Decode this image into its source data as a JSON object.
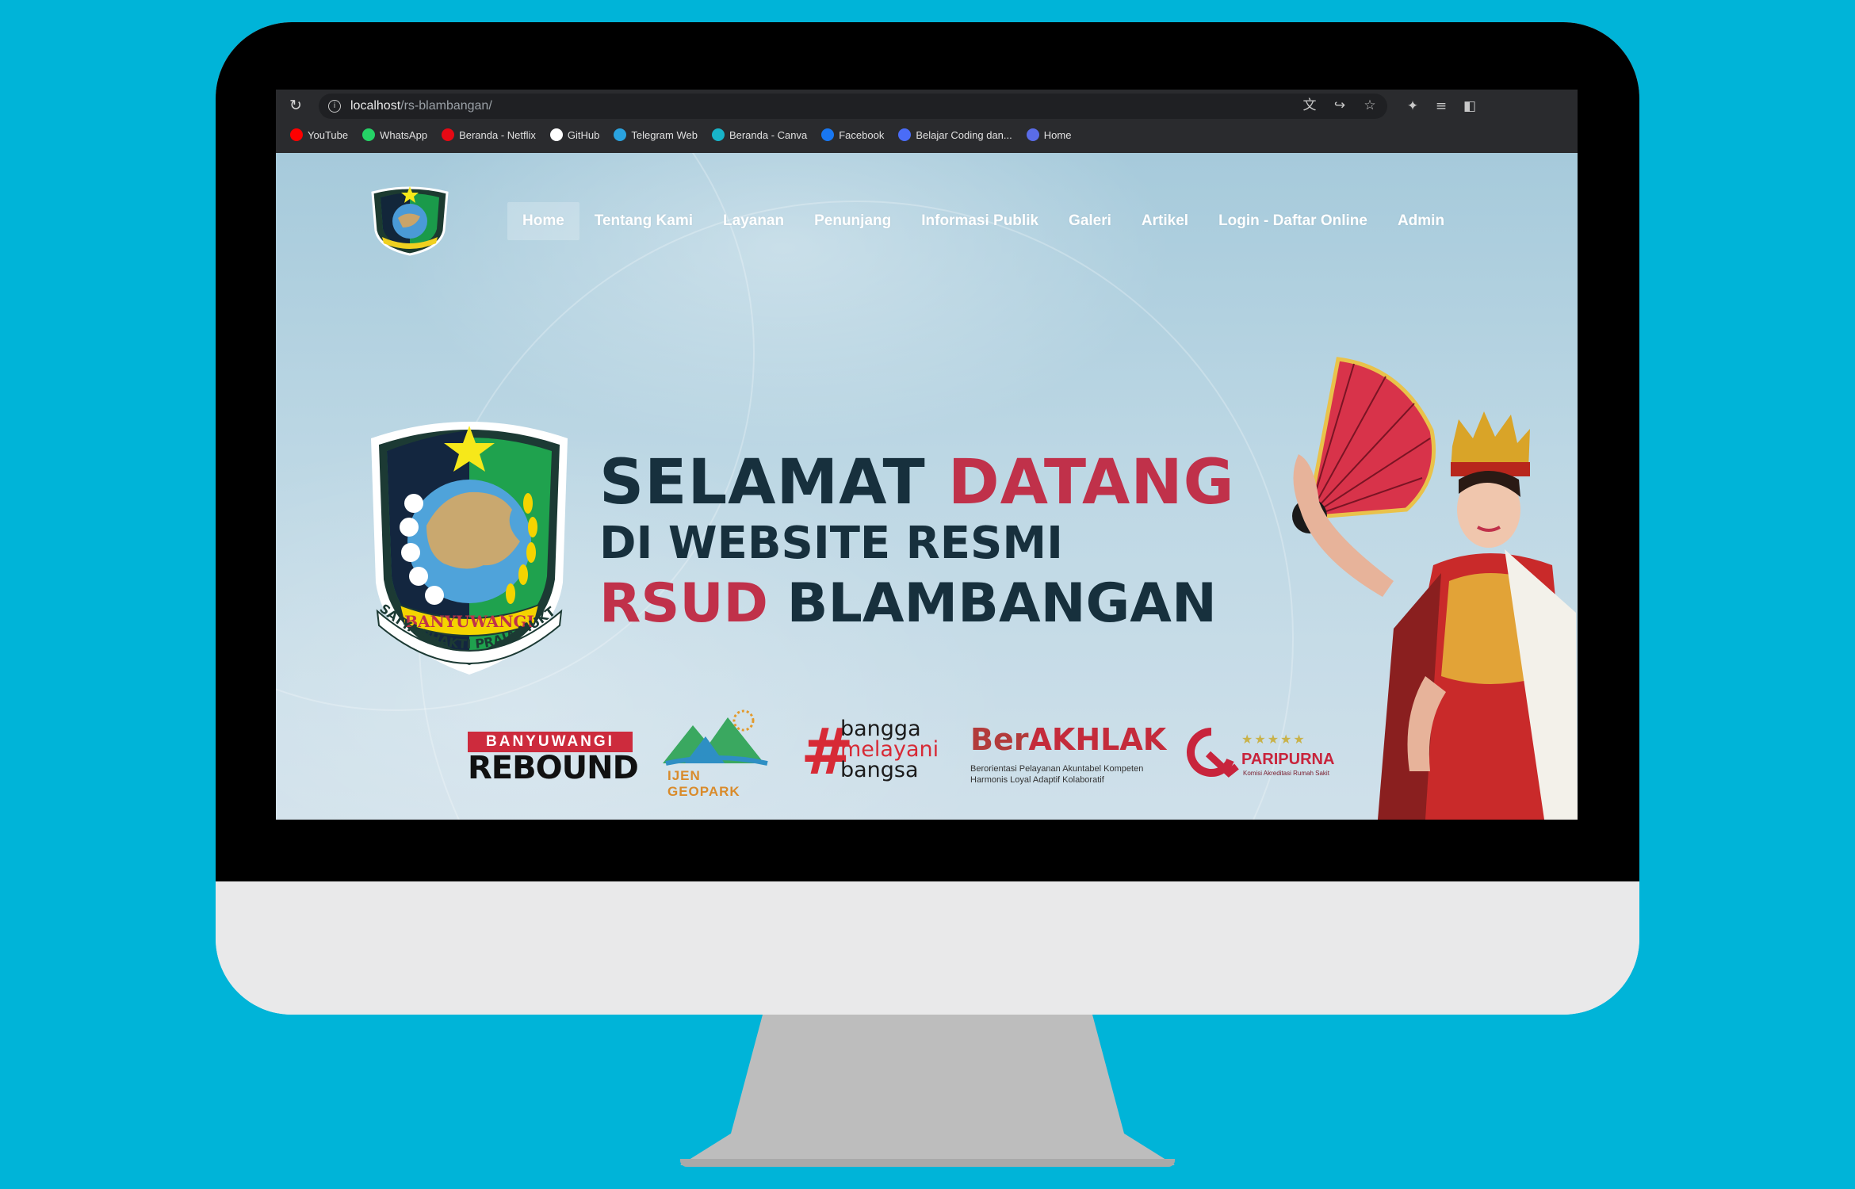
{
  "browser": {
    "url_host": "localhost",
    "url_path": "/rs-blambangan/",
    "bookmarks": [
      {
        "label": "YouTube",
        "icon": "youtube-icon",
        "color": "#ff0000"
      },
      {
        "label": "WhatsApp",
        "icon": "whatsapp-icon",
        "color": "#25d366"
      },
      {
        "label": "Beranda - Netflix",
        "icon": "netflix-icon",
        "color": "#e50914"
      },
      {
        "label": "GitHub",
        "icon": "github-icon",
        "color": "#ffffff"
      },
      {
        "label": "Telegram Web",
        "icon": "telegram-icon",
        "color": "#2aa3df"
      },
      {
        "label": "Beranda - Canva",
        "icon": "canva-icon",
        "color": "#18b4c9"
      },
      {
        "label": "Facebook",
        "icon": "facebook-icon",
        "color": "#1877f2"
      },
      {
        "label": "Belajar Coding dan...",
        "icon": "codepolitan-icon",
        "color": "#4a6cf7"
      },
      {
        "label": "Home",
        "icon": "home-bookmark-icon",
        "color": "#5a6ce8"
      }
    ]
  },
  "site": {
    "nav": [
      {
        "label": "Home",
        "active": true
      },
      {
        "label": "Tentang Kami",
        "active": false
      },
      {
        "label": "Layanan",
        "active": false
      },
      {
        "label": "Penunjang",
        "active": false
      },
      {
        "label": "Informasi Publik",
        "active": false
      },
      {
        "label": "Galeri",
        "active": false
      },
      {
        "label": "Artikel",
        "active": false
      },
      {
        "label": "Login - Daftar Online",
        "active": false
      },
      {
        "label": "Admin",
        "active": false
      }
    ],
    "hero": {
      "line1_dark": "SELAMAT ",
      "line1_red": "DATANG",
      "line2": "DI WEBSITE RESMI",
      "line3_red": "RSUD",
      "line3_dark": " BLAMBANGAN",
      "emblem_ribbon": "BANYUWANGI",
      "emblem_motto": "SATYA BHAKTI PRAJA MUKTI"
    },
    "logos": {
      "rebound_top": "BANYUWANGI",
      "rebound_bottom": "REBOUND",
      "ijen": "IJEN GEOPARK",
      "bangga_1": "bangga",
      "bangga_2": "melayani",
      "bangga_3": "bangsa",
      "berakhlak_1": "Ber",
      "berakhlak_2": "AKHLAK",
      "berakhlak_sub1": "Berorientasi Pelayanan Akuntabel Kompeten",
      "berakhlak_sub2": "Harmonis Loyal Adaptif Kolaboratif",
      "paripurna": "PARIPURNA",
      "paripurna_sub": "Komisi Akreditasi Rumah Sakit"
    },
    "colors": {
      "brand_red": "#c0314a",
      "brand_dark": "#17303d",
      "background": "#00b4d8"
    }
  }
}
